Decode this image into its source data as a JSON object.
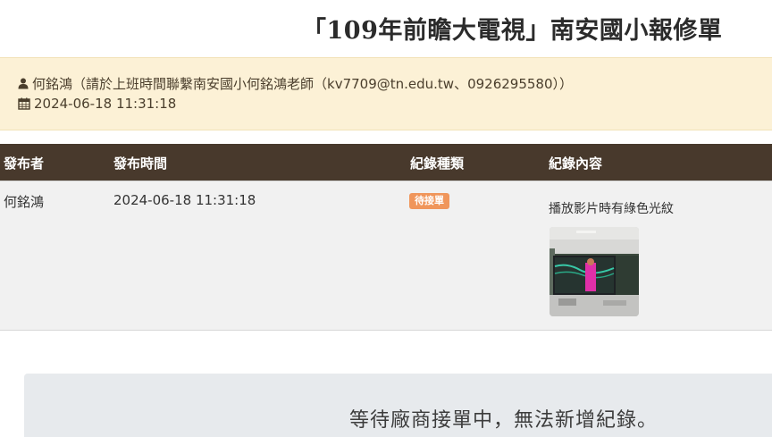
{
  "page": {
    "title": "「109年前瞻大電視」南安國小報修單"
  },
  "info": {
    "contact_icon": "user-icon",
    "contact_text": "何銘鴻（請於上班時間聯繫南安國小何銘鴻老師（kv7709@tn.edu.tw、0926295580））",
    "date_icon": "calendar-icon",
    "date_text": "2024-06-18 11:31:18"
  },
  "table": {
    "headers": {
      "publisher": "發布者",
      "publish_time": "發布時間",
      "record_type": "紀錄種類",
      "record_content": "紀錄內容"
    },
    "rows": [
      {
        "publisher": "何銘鴻",
        "publish_time": "2024-06-18 11:31:18",
        "record_type": "待接單",
        "record_content": "播放影片時有綠色光紋",
        "thumbnail": "classroom-tv-photo"
      }
    ]
  },
  "notice": {
    "text": "等待廠商接單中，無法新增紀錄。"
  },
  "colors": {
    "header_bg": "#48392c",
    "info_bg": "#fcf1d6",
    "badge_bg": "#f0965b",
    "notice_bg": "#e7eaed"
  }
}
